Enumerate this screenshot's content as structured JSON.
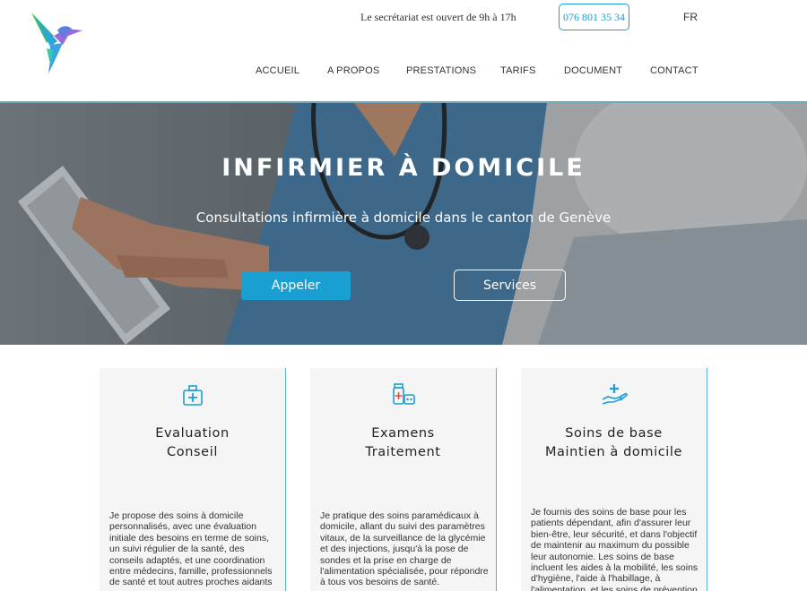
{
  "header": {
    "logo_icon": "hummingbird-logo-icon",
    "secretariat_text": "Le secrétariat est ouvert de 9h à 17h",
    "phone": "076 801 35 34",
    "language": "FR",
    "nav": [
      {
        "label": "ACCUEIL"
      },
      {
        "label": "A PROPOS"
      },
      {
        "label": "PRESTATIONS"
      },
      {
        "label": "TARIFS"
      },
      {
        "label": "DOCUMENT"
      },
      {
        "label": "CONTACT"
      }
    ]
  },
  "hero": {
    "title": "INFIRMIER À DOMICILE",
    "subtitle": "Consultations infirmière à domicile dans le canton de Genève",
    "call_button": "Appeler",
    "services_button": "Services"
  },
  "cards": [
    {
      "icon": "medical-kit-icon",
      "title_line1": "Evaluation",
      "title_line2": "Conseil",
      "text": "Je propose des soins à domicile personnalisés, avec une évaluation initiale des besoins en terme de soins, un suivi régulier de la santé, des conseils adaptés, et une coordination entre médecins, famille, professionnels de santé et tout autres proches aidants"
    },
    {
      "icon": "medication-icon",
      "title_line1": "Examens",
      "title_line2": "Traitement",
      "text": "Je pratique des soins paramédicaux à domicile, allant du suivi des paramètres vitaux, de la surveillance de la glycémie et des injections, jusqu'à la pose de sondes et la prise en charge de l'alimentation spécialisée, pour répondre à tous vos besoins de santé."
    },
    {
      "icon": "caring-hand-icon",
      "title_line1": "Soins de base",
      "title_line2": "Maintien à domicile",
      "text": "Je fournis des soins de base pour les patients dépendant, afin d'assurer leur bien-être, leur sécurité, et dans l'objectif de maintenir au maximum du possible leur autonomie. Les soins de base incluent les aides à la mobilité, les soins d'hygiène, l'aide à l'habillage, à l'alimentation, et les soins de prévention"
    }
  ],
  "colors": {
    "accent": "#1a9fd3",
    "card_bg": "#f5f5f5",
    "card_border": "#56b4d8"
  }
}
